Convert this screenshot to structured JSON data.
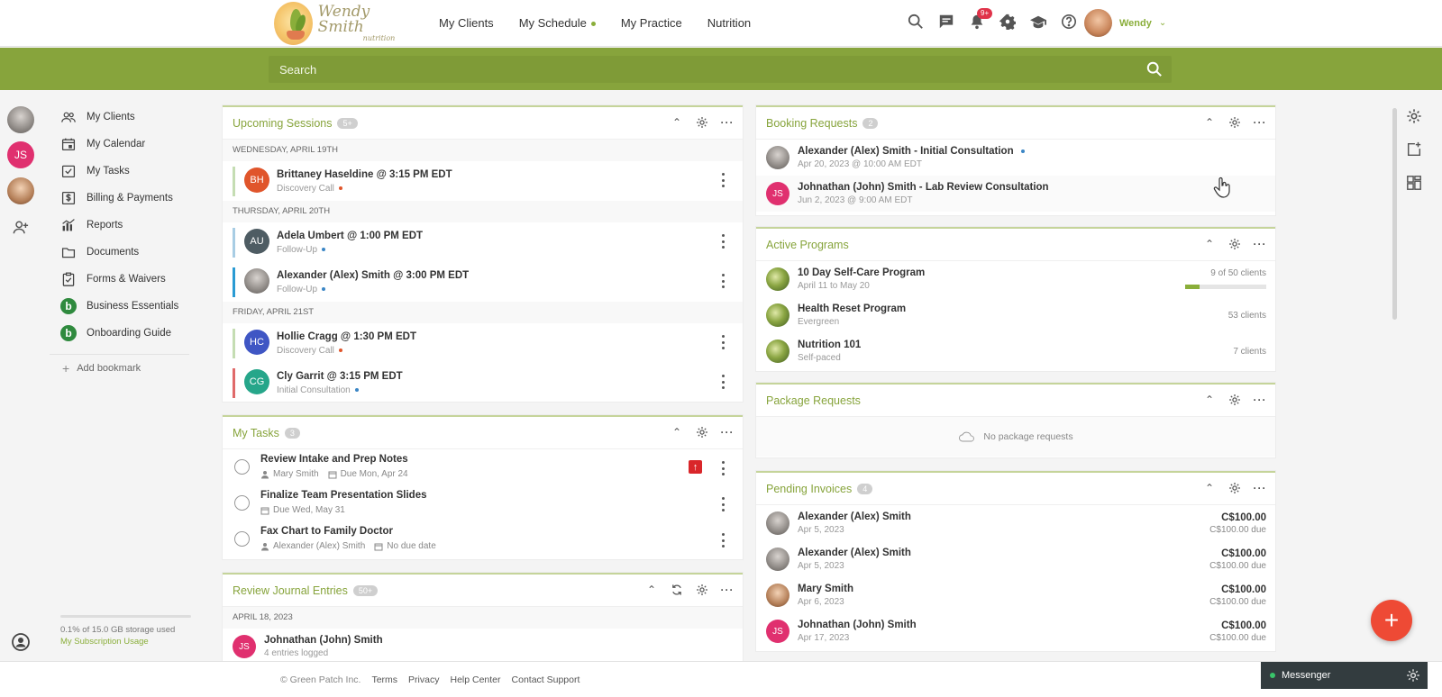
{
  "brand": {
    "line1": "Wendy Smith",
    "line2": "nutrition"
  },
  "nav": {
    "items": [
      "My Clients",
      "My Schedule",
      "My Practice",
      "Nutrition"
    ]
  },
  "header": {
    "notifications_badge": "9+",
    "user_name": "Wendy"
  },
  "search": {
    "placeholder": "Search"
  },
  "rail": {
    "initials": "JS"
  },
  "sidebar": {
    "items": [
      {
        "label": "My Clients",
        "icon": "users-icon"
      },
      {
        "label": "My Calendar",
        "icon": "calendar-icon"
      },
      {
        "label": "My Tasks",
        "icon": "checklist-icon"
      },
      {
        "label": "Billing & Payments",
        "icon": "dollar-icon"
      },
      {
        "label": "Reports",
        "icon": "chart-icon"
      },
      {
        "label": "Documents",
        "icon": "folder-icon"
      },
      {
        "label": "Forms & Waivers",
        "icon": "clipboard-icon"
      },
      {
        "label": "Business Essentials",
        "icon": "b-icon"
      },
      {
        "label": "Onboarding Guide",
        "icon": "b-icon"
      }
    ],
    "add_bookmark": "Add bookmark",
    "storage_text": "0.1% of 15.0 GB storage used",
    "storage_link": "My Subscription Usage"
  },
  "upcoming": {
    "title": "Upcoming Sessions",
    "count": "5+",
    "days": [
      {
        "label": "WEDNESDAY, APRIL 19TH",
        "sessions": [
          {
            "initials": "BH",
            "name": "Brittaney Haseldine @ 3:15 PM EDT",
            "type": "Discovery Call"
          }
        ]
      },
      {
        "label": "THURSDAY, APRIL 20TH",
        "sessions": [
          {
            "initials": "AU",
            "name": "Adela Umbert @ 1:00 PM EDT",
            "type": "Follow-Up"
          },
          {
            "initials": "",
            "name": "Alexander (Alex) Smith @ 3:00 PM EDT",
            "type": "Follow-Up"
          }
        ]
      },
      {
        "label": "FRIDAY, APRIL 21ST",
        "sessions": [
          {
            "initials": "HC",
            "name": "Hollie Cragg @ 1:30 PM EDT",
            "type": "Discovery Call"
          },
          {
            "initials": "CG",
            "name": "Cly Garrit @ 3:15 PM EDT",
            "type": "Initial Consultation"
          }
        ]
      }
    ]
  },
  "tasks": {
    "title": "My Tasks",
    "count": "3",
    "items": [
      {
        "name": "Review Intake and Prep Notes",
        "client": "Mary Smith",
        "due": "Due Mon, Apr 24",
        "priority_icon": "up-arrow-icon"
      },
      {
        "name": "Finalize Team Presentation Slides",
        "client": "",
        "due": "Due Wed, May 31"
      },
      {
        "name": "Fax Chart to Family Doctor",
        "client": "Alexander (Alex) Smith",
        "due": "No due date"
      }
    ]
  },
  "journal": {
    "title": "Review Journal Entries",
    "count": "50+",
    "date_label": "APRIL 18, 2023",
    "entry": {
      "initials": "JS",
      "name": "Johnathan (John) Smith",
      "sub": "4 entries logged"
    }
  },
  "booking": {
    "title": "Booking Requests",
    "count": "2",
    "items": [
      {
        "initials": "",
        "name": "Alexander (Alex) Smith - Initial Consultation",
        "when": "Apr 20, 2023 @ 10:00 AM EDT"
      },
      {
        "initials": "JS",
        "name": "Johnathan (John) Smith - Lab Review Consultation",
        "when": "Jun 2, 2023 @ 9:00 AM EDT"
      }
    ]
  },
  "programs": {
    "title": "Active Programs",
    "items": [
      {
        "name": "10 Day Self-Care Program",
        "sub": "April 11 to May 20",
        "clients": "9 of 50 clients",
        "progress": 0.18
      },
      {
        "name": "Health Reset Program",
        "sub": "Evergreen",
        "clients": "53 clients"
      },
      {
        "name": "Nutrition 101",
        "sub": "Self-paced",
        "clients": "7 clients"
      }
    ]
  },
  "packages": {
    "title": "Package Requests",
    "empty": "No package requests"
  },
  "invoices": {
    "title": "Pending Invoices",
    "count": "4",
    "items": [
      {
        "initials": "",
        "name": "Alexander (Alex) Smith",
        "date": "Apr 5, 2023",
        "amount": "C$100.00",
        "due": "C$100.00 due"
      },
      {
        "initials": "",
        "name": "Alexander (Alex) Smith",
        "date": "Apr 5, 2023",
        "amount": "C$100.00",
        "due": "C$100.00 due"
      },
      {
        "initials": "",
        "name": "Mary Smith",
        "date": "Apr 6, 2023",
        "amount": "C$100.00",
        "due": "C$100.00 due"
      },
      {
        "initials": "JS",
        "name": "Johnathan (John) Smith",
        "date": "Apr 17, 2023",
        "amount": "C$100.00",
        "due": "C$100.00 due"
      }
    ]
  },
  "footer": {
    "copyright": "© Green Patch Inc.",
    "links": [
      "Terms",
      "Privacy",
      "Help Center",
      "Contact Support"
    ],
    "messenger": "Messenger"
  },
  "colors": {
    "accent": "#87a43c",
    "fab": "#ee4a35",
    "priority": "#d9262a"
  }
}
